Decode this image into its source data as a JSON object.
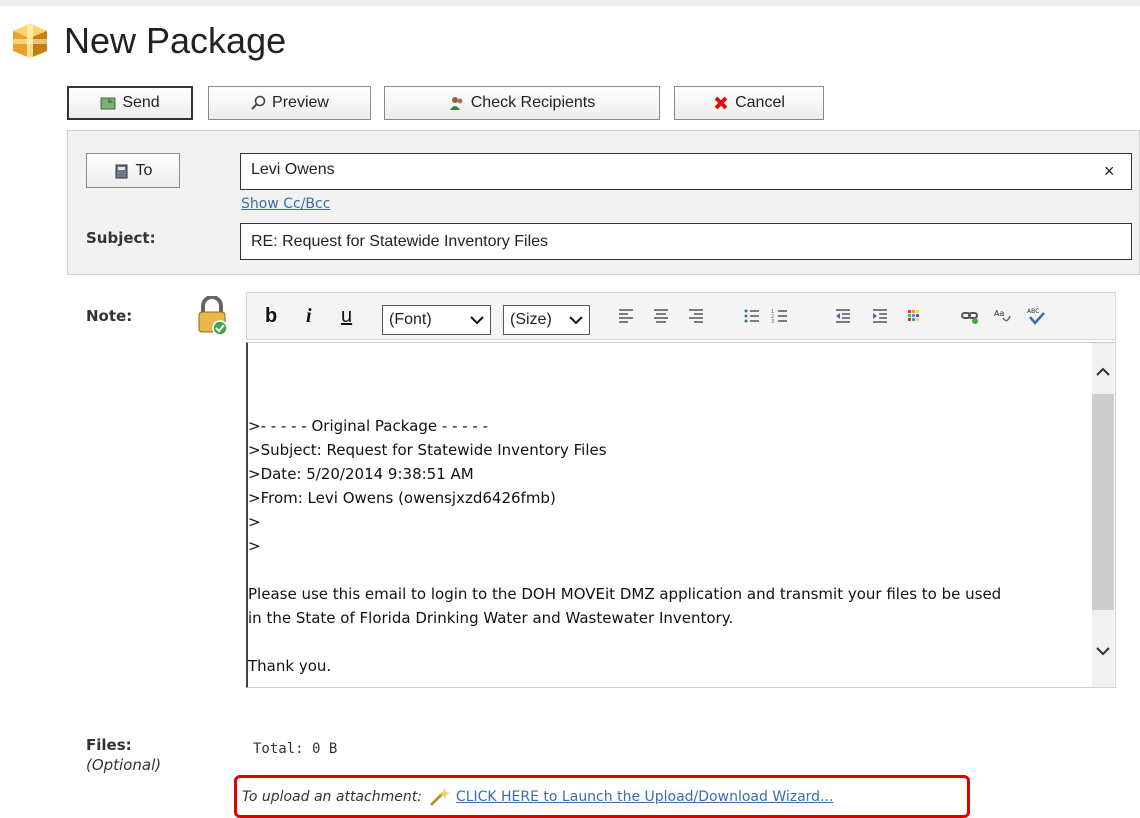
{
  "page": {
    "title": "New Package"
  },
  "toolbar": {
    "send_label": "Send",
    "preview_label": "Preview",
    "check_recipients_label": "Check Recipients",
    "cancel_label": "Cancel"
  },
  "header": {
    "to_button_label": "To",
    "to_value": "Levi Owens",
    "to_clear": "×",
    "show_cc_bcc": "Show Cc/Bcc",
    "subject_label": "Subject:",
    "subject_value": "RE: Request for Statewide Inventory Files"
  },
  "note": {
    "label": "Note:",
    "toolbar": {
      "bold": "b",
      "italic": "i",
      "underline": "u",
      "font_select": "(Font)",
      "size_select": "(Size)"
    },
    "body_lines": [
      ">- - - - - Original Package - - - - -",
      ">Subject: Request for Statewide Inventory Files",
      ">Date: 5/20/2014 9:38:51 AM",
      ">From: Levi Owens (owensjxzd6426fmb)",
      ">",
      ">",
      "",
      "Please use this email to login to the DOH MOVEit DMZ application and transmit your files to be used",
      "in the State of Florida Drinking Water and Wastewater Inventory.",
      "",
      "Thank you."
    ]
  },
  "files": {
    "label": "Files:",
    "optional_label": "(Optional)",
    "total": "Total: 0 B",
    "upload_prompt": "To upload an attachment:",
    "upload_link": "CLICK HERE to Launch the Upload/Download Wizard..."
  },
  "colors": {
    "link": "#3a6ea5",
    "highlight_border": "#e00000"
  }
}
